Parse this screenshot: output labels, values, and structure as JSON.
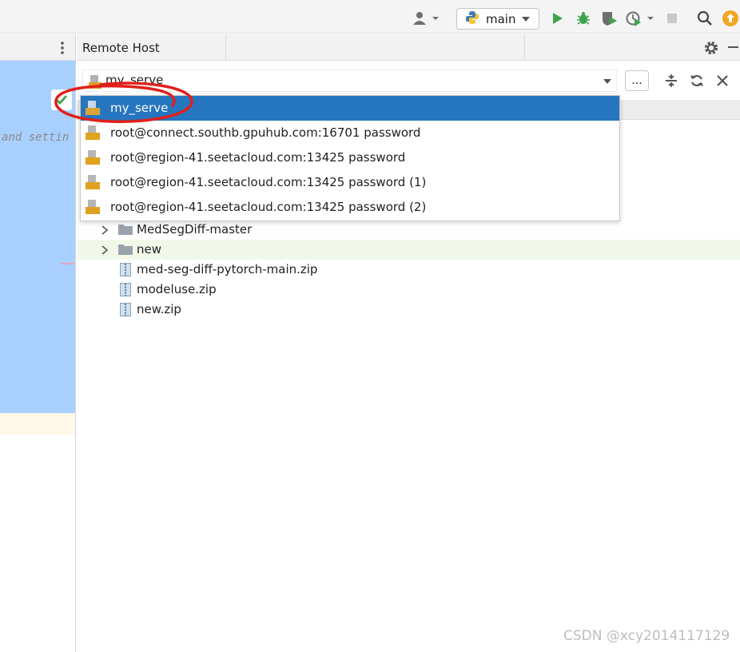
{
  "toolbar": {
    "config_label": "main",
    "icons": [
      "user-icon",
      "python-icon",
      "run-icon",
      "debug-icon",
      "coverage-icon",
      "profile-icon",
      "stop-icon",
      "search-icon",
      "update-icon"
    ]
  },
  "left_pane": {
    "code_fragment": "and settin"
  },
  "remote_host": {
    "title": "Remote Host",
    "selected_server": "my_serve",
    "more_button": "...",
    "servers": [
      {
        "label": "my_serve",
        "icon": "sftp-icon",
        "selected": true
      },
      {
        "label": "root@connect.southb.gpuhub.com:16701 password",
        "icon": "sftp-icon",
        "selected": false
      },
      {
        "label": "root@region-41.seetacloud.com:13425 password",
        "icon": "sftp-icon",
        "selected": false
      },
      {
        "label": "root@region-41.seetacloud.com:13425 password (1)",
        "icon": "sftp-icon",
        "selected": false
      },
      {
        "label": "root@region-41.seetacloud.com:13425 password (2)",
        "icon": "sftp-icon",
        "selected": false
      }
    ],
    "tree": [
      {
        "label": "MedSegDiff-master",
        "type": "folder"
      },
      {
        "label": "new",
        "type": "folder"
      },
      {
        "label": "med-seg-diff-pytorch-main.zip",
        "type": "zip"
      },
      {
        "label": "modeluse.zip",
        "type": "zip"
      },
      {
        "label": "new.zip",
        "type": "zip"
      }
    ]
  },
  "watermark": "CSDN @xcy2014117129",
  "colors": {
    "selection_blue": "#2675bf",
    "left_selection": "#a8d0ff",
    "annotation_red": "#e0201a"
  }
}
